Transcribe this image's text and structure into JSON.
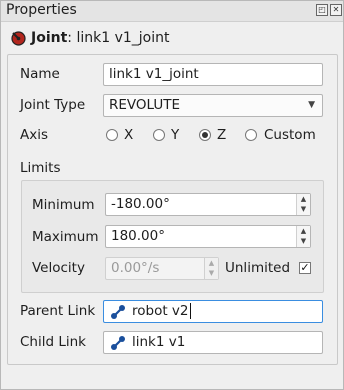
{
  "window": {
    "title": "Properties"
  },
  "header": {
    "type_label": "Joint",
    "name": "link1 v1_joint"
  },
  "name_row": {
    "label": "Name",
    "value": "link1 v1_joint"
  },
  "joint_type_row": {
    "label": "Joint Type",
    "value": "REVOLUTE"
  },
  "axis_row": {
    "label": "Axis",
    "options": [
      {
        "label": "X",
        "selected": false
      },
      {
        "label": "Y",
        "selected": false
      },
      {
        "label": "Z",
        "selected": true
      },
      {
        "label": "Custom",
        "selected": false
      }
    ]
  },
  "limits": {
    "title": "Limits",
    "minimum": {
      "label": "Minimum",
      "value": "-180.00°"
    },
    "maximum": {
      "label": "Maximum",
      "value": "180.00°"
    },
    "velocity": {
      "label": "Velocity",
      "value": "0.00°/s",
      "unlimited_label": "Unlimited",
      "unlimited_checked": true
    }
  },
  "parent_link": {
    "label": "Parent Link",
    "value": "robot v2"
  },
  "child_link": {
    "label": "Child Link",
    "value": "link1 v1"
  },
  "colors": {
    "accent": "#3a8de0",
    "joint_icon": "#b3261e",
    "link_icon": "#1a4f9c"
  },
  "icons": {
    "joint": "joint-icon",
    "link": "link-icon",
    "float": "float-icon",
    "close": "close-icon"
  }
}
